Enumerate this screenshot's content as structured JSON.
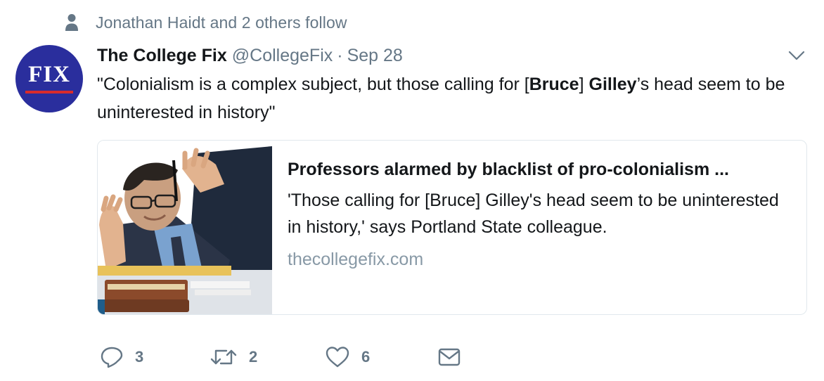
{
  "social_context": {
    "text": "Jonathan Haidt and 2 others follow",
    "icon": "person-icon"
  },
  "avatar": {
    "logo_text": "FIX",
    "colors": {
      "background": "#2a2e9d",
      "stripe": "#d92b2b",
      "text": "#ffffff"
    }
  },
  "tweet": {
    "display_name": "The College Fix",
    "handle": "@CollegeFix",
    "separator": "·",
    "timestamp": "Sep 28",
    "text_parts": {
      "p1": "\"Colonialism is a complex subject, but those calling for [",
      "bold1": "Bruce",
      "p2": "] ",
      "bold2": "Gilley",
      "p3": "’s head seem to be uninterested in history\""
    }
  },
  "card": {
    "title": "Professors alarmed by blacklist of pro-colonialism ...",
    "description": "'Those calling for [Bruce] Gilley's head seem to be uninterested in history,' says Portland State colleague.",
    "domain": "thecollegefix.com"
  },
  "actions": {
    "reply_count": "3",
    "retweet_count": "2",
    "like_count": "6"
  },
  "colors": {
    "primary_text": "#14171a",
    "secondary_text": "#657786",
    "domain_text": "#8899a6",
    "border": "#e1e8ed"
  }
}
